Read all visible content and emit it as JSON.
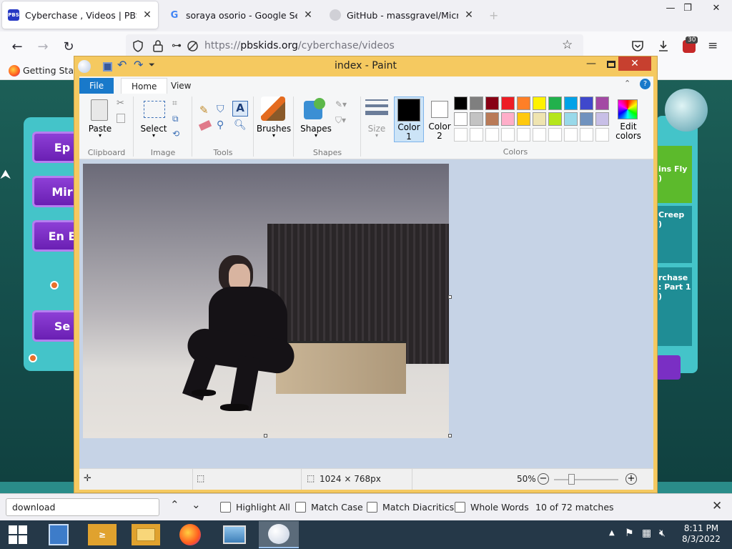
{
  "browser": {
    "tabs": [
      {
        "title": "Cyberchase , Videos | PBS KIDS",
        "favicon_text": "PBS KIDS",
        "favicon_color": "#2638c4"
      },
      {
        "title": "soraya osorio - Google Search",
        "favicon_text": "G"
      },
      {
        "title": "GitHub - massgravel/Microsoft-",
        "favicon_text": ""
      }
    ],
    "url_prefix": "https://",
    "url_domain": "pbskids.org",
    "url_path": "/cyberchase/videos",
    "bookmark": "Getting Starte",
    "notification_count": "30"
  },
  "page_buttons": [
    "Ep",
    "Mir",
    "En E",
    "Se"
  ],
  "right_cards": [
    "ins Fly\n)",
    "Creep\n)",
    "rchase\n: Part 1\n)"
  ],
  "paint": {
    "title": "index - Paint",
    "tabs": {
      "file": "File",
      "home": "Home",
      "view": "View"
    },
    "groups": {
      "clipboard": "Clipboard",
      "image": "Image",
      "tools": "Tools",
      "shapes": "Shapes",
      "colors": "Colors"
    },
    "buttons": {
      "paste": "Paste",
      "select": "Select",
      "brushes": "Brushes",
      "shapes": "Shapes",
      "size": "Size",
      "color1": "Color\n1",
      "color2": "Color\n2",
      "edit_colors": "Edit\ncolors"
    },
    "palette_row1": [
      "#000000",
      "#7f7f7f",
      "#880015",
      "#ed1c24",
      "#ff7f27",
      "#fff200",
      "#22b14c",
      "#00a2e8",
      "#3f48cc",
      "#a349a4"
    ],
    "palette_row2": [
      "#ffffff",
      "#c3c3c3",
      "#b97a57",
      "#ffaec9",
      "#ffc90e",
      "#efe4b0",
      "#b5e61d",
      "#99d9ea",
      "#7092be",
      "#c8bfe7"
    ],
    "status": {
      "dimensions": "1024 × 768px",
      "zoom": "50%"
    }
  },
  "findbar": {
    "query": "download",
    "options": [
      "Highlight All",
      "Match Case",
      "Match Diacritics",
      "Whole Words"
    ],
    "matches": "10 of 72 matches"
  },
  "taskbar": {
    "time": "8:11 PM",
    "date": "8/3/2022"
  }
}
